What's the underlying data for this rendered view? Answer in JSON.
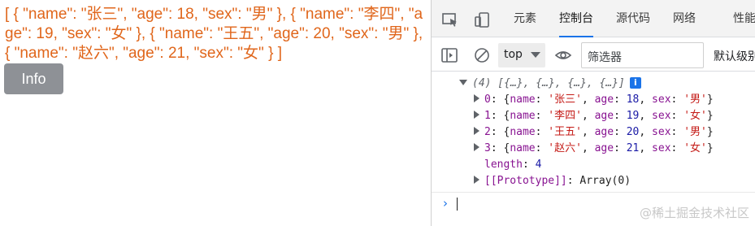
{
  "page": {
    "json_text": "[ { \"name\": \"张三\", \"age\": 18, \"sex\": \"男\" }, { \"name\": \"李四\", \"age\": 19, \"sex\": \"女\" }, { \"name\": \"王五\", \"age\": 20, \"sex\": \"男\" }, { \"name\": \"赵六\", \"age\": 21, \"sex\": \"女\" } ]",
    "info_button": "Info",
    "text_color": "#e0661b",
    "button_color": "#8e9196"
  },
  "devtools": {
    "tabs": [
      {
        "label": "元素"
      },
      {
        "label": "控制台"
      },
      {
        "label": "源代码"
      },
      {
        "label": "网络"
      },
      {
        "label": "性能"
      }
    ],
    "active_tab": "控制台",
    "accent": "#1a73e8",
    "toolbar": {
      "context": "top",
      "filter_placeholder": "筛选器",
      "levels": "默认级别"
    },
    "console": {
      "summary": "(4) [{…}, {…}, {…}, {…}]",
      "badge": "i",
      "items": [
        {
          "index": "0",
          "name": "'张三'",
          "age": "18",
          "sex": "'男'"
        },
        {
          "index": "1",
          "name": "'李四'",
          "age": "19",
          "sex": "'女'"
        },
        {
          "index": "2",
          "name": "'王五'",
          "age": "20",
          "sex": "'男'"
        },
        {
          "index": "3",
          "name": "'赵六'",
          "age": "21",
          "sex": "'女'"
        }
      ],
      "length_key": "length",
      "length_value": "4",
      "prototype_key": "[[Prototype]]",
      "prototype_value": "Array(0)",
      "prompt": "›"
    },
    "watermark": "@稀土掘金技术社区"
  }
}
